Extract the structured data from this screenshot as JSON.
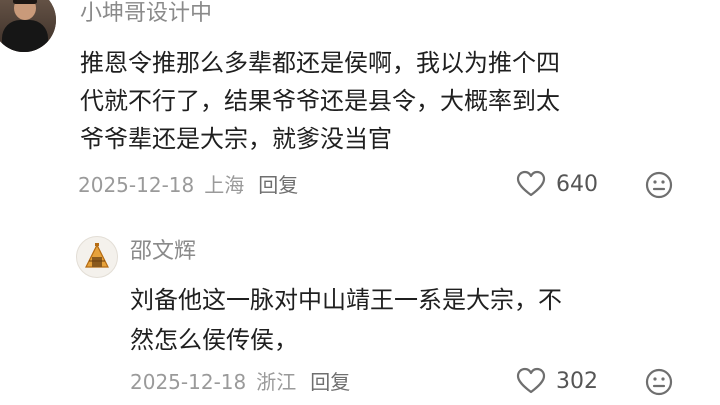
{
  "colors": {
    "text_primary": "#1f1f1f",
    "text_secondary": "#9a9a9a",
    "username": "#8a8a8a",
    "icon": "#6f6f6f"
  },
  "main_comment": {
    "username": "小坤哥设计中",
    "text_lines": [
      "推恩令推那么多辈都还是侯啊，我以为推个四",
      "代就不行了，结果爷爷还是县令，大概率到太",
      "爷爷辈还是大宗，就爹没当官"
    ],
    "date": "2025-12-18",
    "location": "上海",
    "reply_label": "回复",
    "like_count": "640",
    "like_icon": "heart-outline-icon",
    "dislike_icon": "meh-face-icon"
  },
  "reply_comment": {
    "username": "邵文辉",
    "text_lines": [
      "刘备他这一脉对中山靖王一系是大宗，不",
      "然怎么侯传侯，"
    ],
    "date": "2025-12-18",
    "location": "浙江",
    "reply_label": "回复",
    "like_count": "302",
    "like_icon": "heart-outline-icon",
    "dislike_icon": "meh-face-icon"
  }
}
